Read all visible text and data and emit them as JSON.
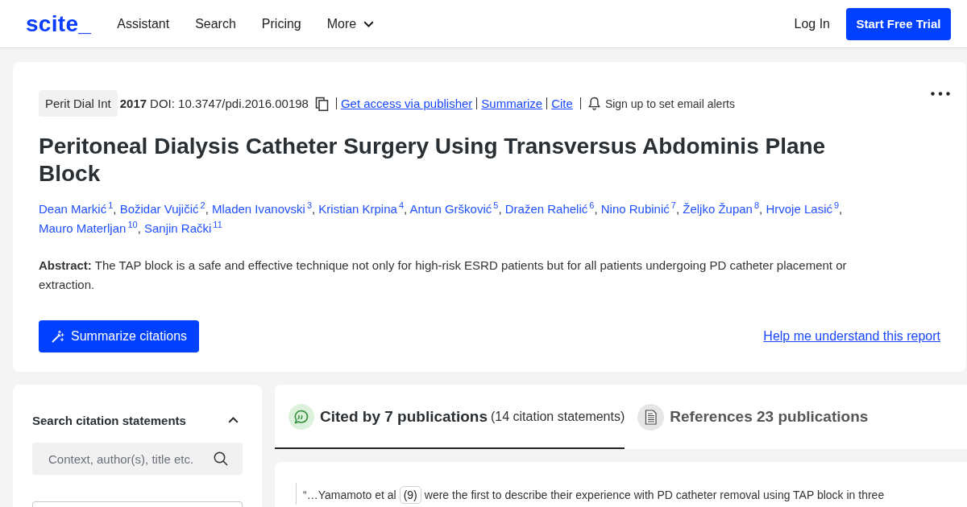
{
  "header": {
    "logo": "scite_",
    "nav": [
      {
        "label": "Assistant",
        "kind": "link"
      },
      {
        "label": "Search",
        "kind": "link"
      },
      {
        "label": "Pricing",
        "kind": "link"
      },
      {
        "label": "More",
        "kind": "dropdown"
      }
    ],
    "login": "Log In",
    "cta": "Start Free Trial"
  },
  "article": {
    "journal": "Perit Dial Int",
    "year": "2017",
    "doi": "DOI: 10.3747/pdi.2016.00198",
    "links": [
      "Get access via publisher",
      "Summarize",
      "Cite"
    ],
    "alerts": "Sign up to set email alerts",
    "title": "Peritoneal Dialysis Catheter Surgery Using Transversus Abdominis Plane Block",
    "author_separator": ",",
    "authors": [
      {
        "name": "Dean Markić",
        "affiliation": "1"
      },
      {
        "name": "Božidar Vujičić",
        "affiliation": "2"
      },
      {
        "name": "Mladen Ivanovski",
        "affiliation": "3"
      },
      {
        "name": "Kristian Krpina",
        "affiliation": "4"
      },
      {
        "name": "Antun Gršković",
        "affiliation": "5"
      },
      {
        "name": "Dražen Rahelić",
        "affiliation": "6"
      },
      {
        "name": "Nino Rubinić",
        "affiliation": "7"
      },
      {
        "name": "Željko Župan",
        "affiliation": "8"
      },
      {
        "name": "Hrvoje Lasić",
        "affiliation": "9"
      },
      {
        "name": "Mauro Materljan",
        "affiliation": "10"
      },
      {
        "name": "Sanjin Rački",
        "affiliation": "11"
      }
    ],
    "abstract": "**Abstract:** The TAP block is a safe and effective technique not only for high-risk ESRD patients but for all patients undergoing PD catheter placement or extraction.",
    "summarize_button": "Summarize citations",
    "help_link": "Help me understand this report"
  },
  "search_panel": {
    "title": "Search citation statements",
    "expanded": true,
    "search": {
      "placeholder": "Context, author(s), title etc."
    }
  },
  "tabs": [
    {
      "kind": "cited",
      "label": "Cited by 7 publications",
      "detail": "(14 citation statements)",
      "selected": true
    },
    {
      "kind": "references",
      "label": "References 23 publications",
      "selected": false
    }
  ],
  "citations": [
    {
      "before": "“…Yamamoto et al",
      "ref": "(9)",
      "after": "were the first to describe their experience with PD catheter removal using TAP block in three"
    }
  ]
}
